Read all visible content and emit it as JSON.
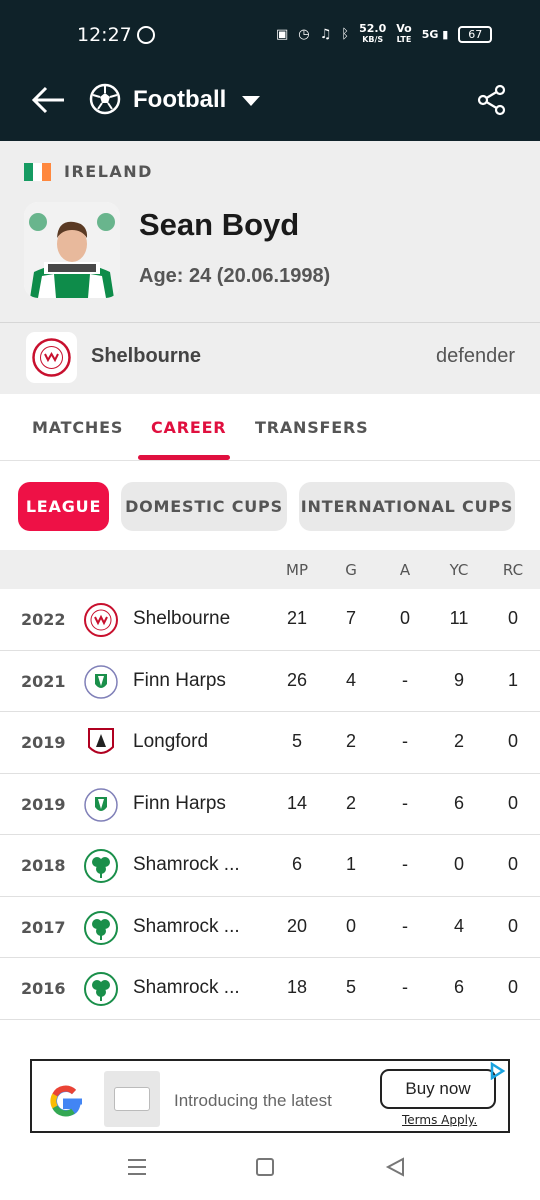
{
  "status_bar": {
    "time": "12:27",
    "speed_value": "52.0",
    "speed_unit": "KB/S",
    "net_label_top": "Vo",
    "net_label_bottom": "LTE",
    "signal_label": "5G",
    "battery": "67"
  },
  "appbar": {
    "title": "Football",
    "back_icon": "arrow-left-icon",
    "sport_icon": "soccer-ball-icon",
    "share_icon": "share-icon"
  },
  "player": {
    "country": "IRELAND",
    "flag_colors": [
      "#169b62",
      "#ffffff",
      "#ff883e"
    ],
    "name": "Sean Boyd",
    "age_label": "Age: 24 (20.06.1998)"
  },
  "club": {
    "name": "Shelbourne",
    "position": "defender"
  },
  "tabs": [
    {
      "label": "MATCHES"
    },
    {
      "label": "CAREER"
    },
    {
      "label": "TRANSFERS"
    }
  ],
  "active_tab": "CAREER",
  "filters": [
    {
      "label": "LEAGUE"
    },
    {
      "label": "DOMESTIC CUPS"
    },
    {
      "label": "INTERNATIONAL CUPS"
    }
  ],
  "active_filter": "LEAGUE",
  "table": {
    "columns": [
      "MP",
      "G",
      "A",
      "YC",
      "RC"
    ],
    "rows": [
      {
        "year": "2022",
        "team": "Shelbourne",
        "crest": "shelbourne",
        "mp": "21",
        "g": "7",
        "a": "0",
        "yc": "11",
        "rc": "0"
      },
      {
        "year": "2021",
        "team": "Finn Harps",
        "crest": "finn-harps",
        "mp": "26",
        "g": "4",
        "a": "-",
        "yc": "9",
        "rc": "1"
      },
      {
        "year": "2019",
        "team": "Longford",
        "crest": "longford",
        "mp": "5",
        "g": "2",
        "a": "-",
        "yc": "2",
        "rc": "0"
      },
      {
        "year": "2019",
        "team": "Finn Harps",
        "crest": "finn-harps",
        "mp": "14",
        "g": "2",
        "a": "-",
        "yc": "6",
        "rc": "0"
      },
      {
        "year": "2018",
        "team": "Shamrock ...",
        "crest": "shamrock",
        "mp": "6",
        "g": "1",
        "a": "-",
        "yc": "0",
        "rc": "0"
      },
      {
        "year": "2017",
        "team": "Shamrock ...",
        "crest": "shamrock",
        "mp": "20",
        "g": "0",
        "a": "-",
        "yc": "4",
        "rc": "0"
      },
      {
        "year": "2016",
        "team": "Shamrock ...",
        "crest": "shamrock",
        "mp": "18",
        "g": "5",
        "a": "-",
        "yc": "6",
        "rc": "0"
      }
    ]
  },
  "ad": {
    "text": "Introducing the latest",
    "cta": "Buy now",
    "terms": "Terms Apply."
  },
  "colors": {
    "accent": "#e0103f",
    "header_bg": "#0f2229"
  }
}
